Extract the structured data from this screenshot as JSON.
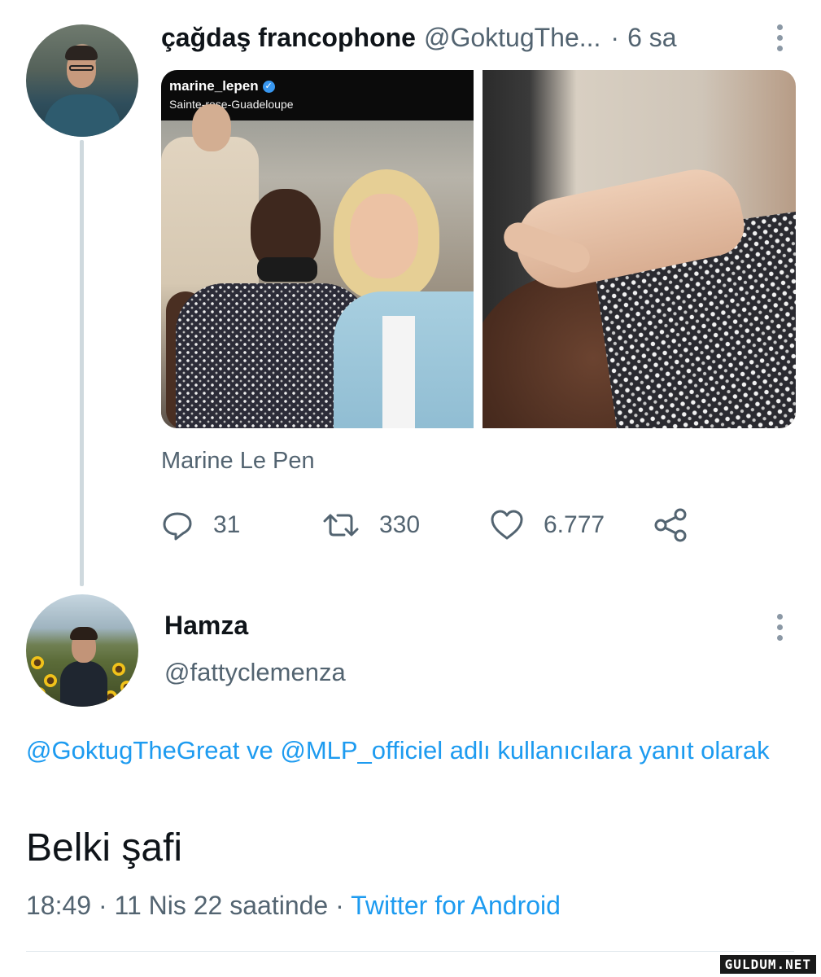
{
  "original_tweet": {
    "display_name": "çağdaş francophone",
    "handle": "@GoktugThe...",
    "separator": "·",
    "time": "6 sa",
    "media": {
      "left_image": {
        "instagram_user": "marine_lepen",
        "instagram_location": "Sainte-rose-Guadeloupe"
      }
    },
    "caption": "Marine Le Pen",
    "actions": {
      "reply_count": "31",
      "retweet_count": "330",
      "like_count": "6.777"
    }
  },
  "reply_tweet": {
    "display_name": "Hamza",
    "handle": "@fattyclemenza",
    "reply_to": {
      "mention_1": "@GoktugTheGreat",
      "connector": " ve ",
      "mention_2": "@MLP_officiel",
      "suffix": " adlı kullanıcılara yanıt olarak"
    },
    "text": "Belki şafi",
    "meta": {
      "time": "18:49",
      "separator": " · ",
      "date": "11 Nis 22 saatinde",
      "source": "Twitter for Android"
    }
  },
  "watermark": "GULDUM.NET",
  "colors": {
    "link": "#1d9bf0",
    "secondary_text": "#536471",
    "primary_text": "#0f1419",
    "thread_line": "#cfd9de"
  },
  "icons": [
    "more-options-icon",
    "reply-icon",
    "retweet-icon",
    "like-icon",
    "share-icon",
    "verified-icon"
  ]
}
